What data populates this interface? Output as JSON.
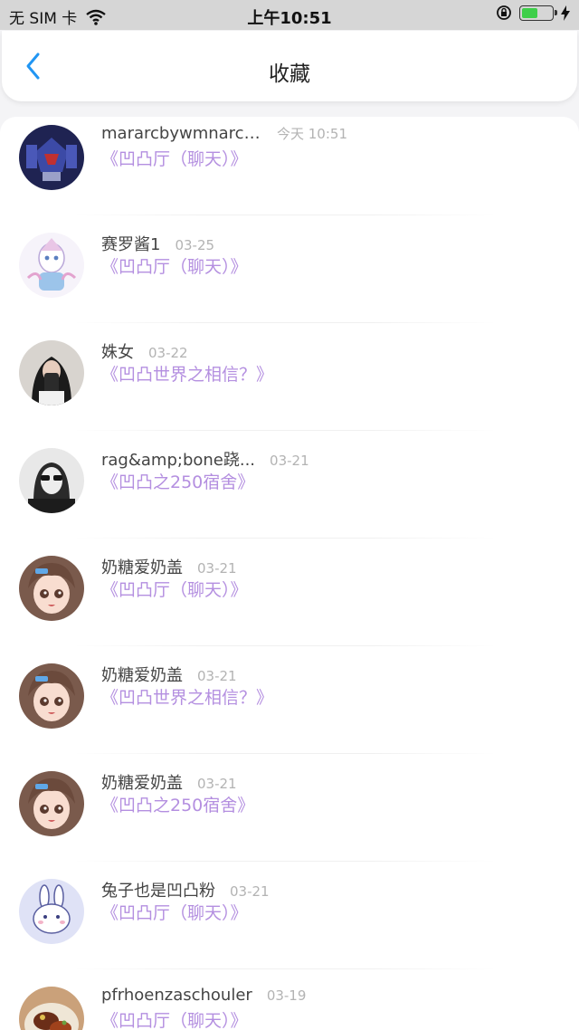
{
  "status_bar": {
    "carrier": "无 SIM 卡",
    "time": "上午10:51",
    "battery_level": 0.55
  },
  "nav": {
    "title": "收藏",
    "back_icon": "chevron-left-icon",
    "accent_color": "#2196f3"
  },
  "room_color": "#b48fe0",
  "favorites": [
    {
      "name": "mararcbywmnarcj...",
      "time": "今天 10:51",
      "room": "《凹凸厅（聊天）》",
      "avatar": "robot-avatar"
    },
    {
      "name": "赛罗酱1",
      "time": "03-25",
      "room": "《凹凸厅（聊天）》",
      "avatar": "anime-hero-avatar"
    },
    {
      "name": "姝女",
      "time": "03-22",
      "room": "《凹凸世界之相信？》",
      "avatar": "selfie-avatar"
    },
    {
      "name": "rag&amp;bone跷...",
      "time": "03-21",
      "room": "《凹凸之250宿舍》",
      "avatar": "sunglasses-avatar"
    },
    {
      "name": "奶糖爱奶盖",
      "time": "03-21",
      "room": "《凹凸厅（聊天）》",
      "avatar": "anime-girl-avatar"
    },
    {
      "name": "奶糖爱奶盖",
      "time": "03-21",
      "room": "《凹凸世界之相信？》",
      "avatar": "anime-girl-avatar"
    },
    {
      "name": "奶糖爱奶盖",
      "time": "03-21",
      "room": "《凹凸之250宿舍》",
      "avatar": "anime-girl-avatar"
    },
    {
      "name": "兔子也是凹凸粉",
      "time": "03-21",
      "room": "《凹凸厅（聊天）》",
      "avatar": "bunny-avatar"
    },
    {
      "name": "pfrhoenzaschouler",
      "time": "03-19",
      "room": "《凹凸厅（聊天）》",
      "avatar": "food-avatar"
    }
  ]
}
